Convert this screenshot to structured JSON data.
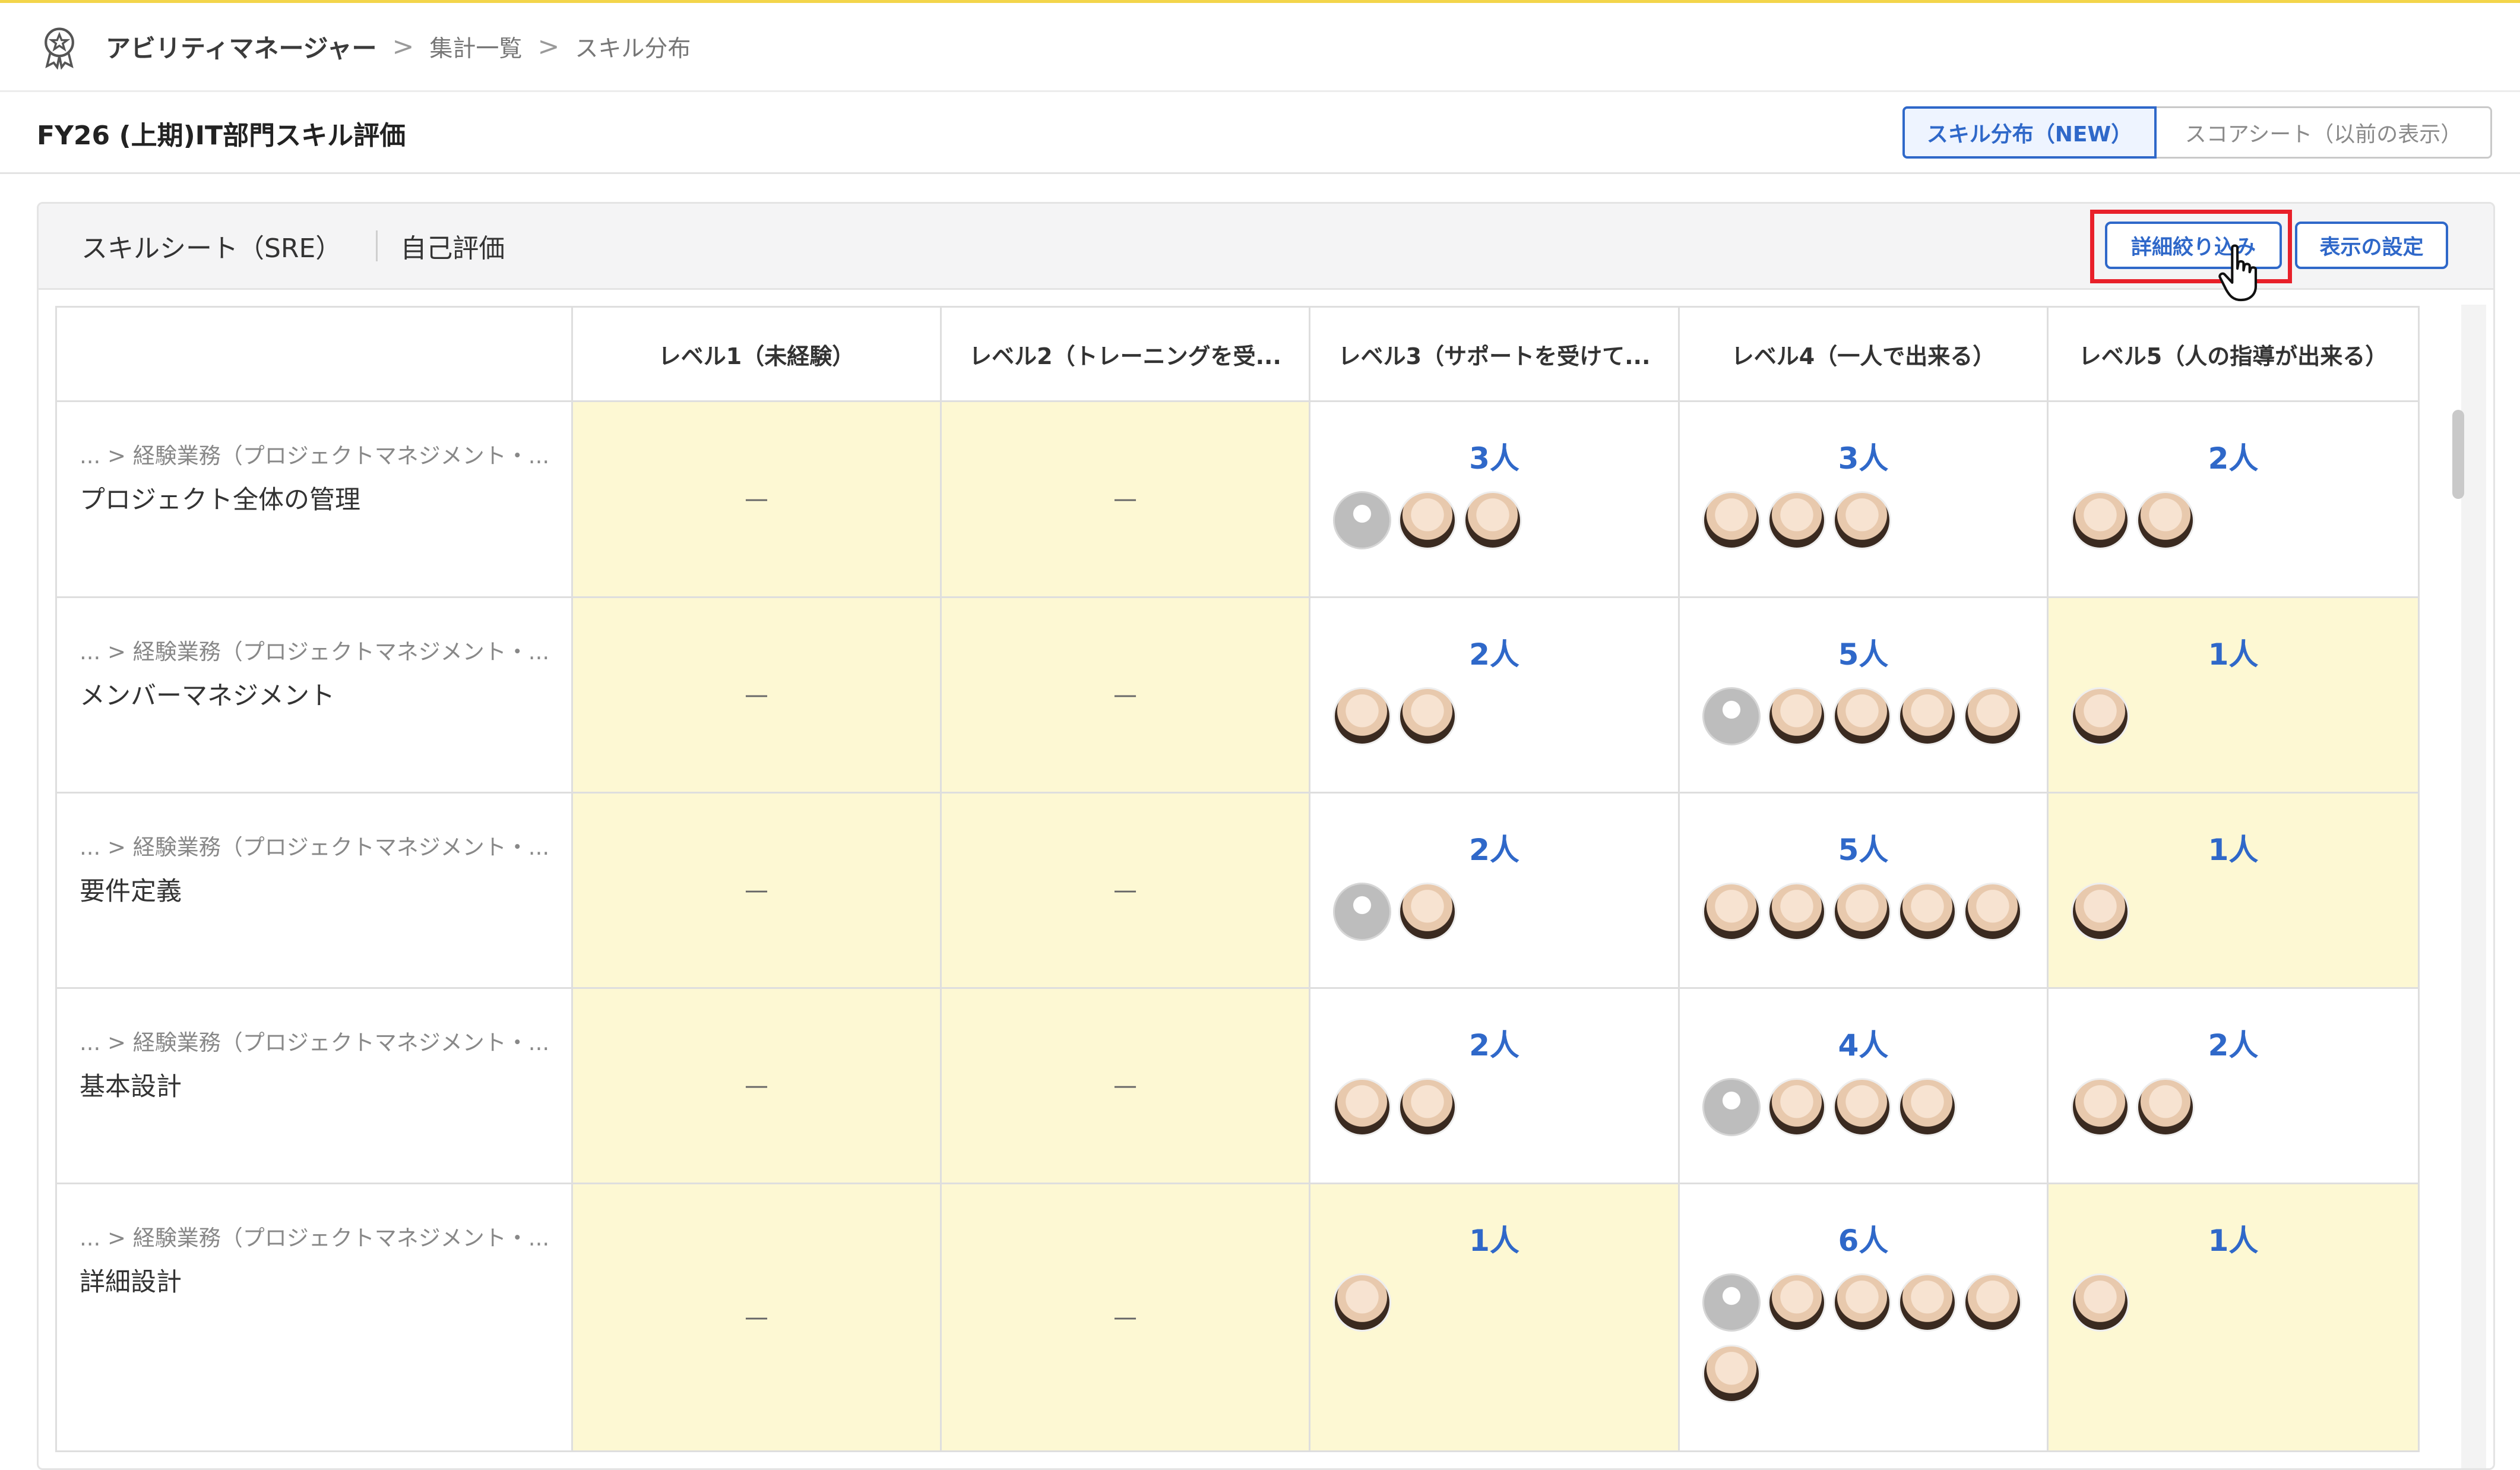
{
  "breadcrumb": {
    "app": "アビリティマネージャー",
    "sep1": ">",
    "item1": "集計一覧",
    "sep2": ">",
    "item2": "スキル分布",
    "logo_icon": "award-ribbon-icon"
  },
  "page": {
    "title": "FY26 (上期)IT部門スキル評価",
    "view_active": "スキル分布（NEW）",
    "view_inactive": "スコアシート（以前の表示）"
  },
  "panel": {
    "sheet_name": "スキルシート（SRE）",
    "eval_type": "自己評価",
    "filter_button": "詳細絞り込み",
    "settings_button": "表示の設定"
  },
  "colors": {
    "accent": "#2f68c9",
    "highlight_cell": "#fdf8d3",
    "annotation_red": "#e8202a"
  },
  "table": {
    "headers": [
      "",
      "レベル1（未経験）",
      "レベル2（トレーニングを受...",
      "レベル3（サポートを受けて...",
      "レベル4（一人で出来る）",
      "レベル5（人の指導が出来る）"
    ],
    "rows": [
      {
        "path": "... > 経験業務（プロジェクトマネジメント・...",
        "name": "プロジェクト全体の管理",
        "cells": [
          {
            "text": "—",
            "avatars": []
          },
          {
            "text": "—",
            "avatars": []
          },
          {
            "text": "3人",
            "avatars": [
              "anon",
              "p",
              "p"
            ]
          },
          {
            "text": "3人",
            "avatars": [
              "p",
              "p",
              "p"
            ]
          },
          {
            "text": "2人",
            "avatars": [
              "p",
              "p"
            ]
          }
        ]
      },
      {
        "path": "... > 経験業務（プロジェクトマネジメント・...",
        "name": "メンバーマネジメント",
        "cells": [
          {
            "text": "—",
            "avatars": []
          },
          {
            "text": "—",
            "avatars": []
          },
          {
            "text": "2人",
            "avatars": [
              "p",
              "p"
            ]
          },
          {
            "text": "5人",
            "avatars": [
              "anon",
              "p",
              "p",
              "p",
              "p"
            ]
          },
          {
            "text": "1人",
            "avatars": [
              "p"
            ]
          }
        ]
      },
      {
        "path": "... > 経験業務（プロジェクトマネジメント・...",
        "name": "要件定義",
        "cells": [
          {
            "text": "—",
            "avatars": []
          },
          {
            "text": "—",
            "avatars": []
          },
          {
            "text": "2人",
            "avatars": [
              "anon",
              "p"
            ]
          },
          {
            "text": "5人",
            "avatars": [
              "p",
              "p",
              "p",
              "p",
              "p"
            ]
          },
          {
            "text": "1人",
            "avatars": [
              "p"
            ]
          }
        ]
      },
      {
        "path": "... > 経験業務（プロジェクトマネジメント・...",
        "name": "基本設計",
        "cells": [
          {
            "text": "—",
            "avatars": []
          },
          {
            "text": "—",
            "avatars": []
          },
          {
            "text": "2人",
            "avatars": [
              "p",
              "p"
            ]
          },
          {
            "text": "4人",
            "avatars": [
              "anon",
              "p",
              "p",
              "p"
            ]
          },
          {
            "text": "2人",
            "avatars": [
              "p",
              "p"
            ]
          }
        ]
      },
      {
        "path": "... > 経験業務（プロジェクトマネジメント・...",
        "name": "詳細設計",
        "cells": [
          {
            "text": "—",
            "avatars": []
          },
          {
            "text": "—",
            "avatars": []
          },
          {
            "text": "1人",
            "avatars": [
              "p"
            ]
          },
          {
            "text": "6人",
            "avatars": [
              "anon",
              "p",
              "p",
              "p",
              "p",
              "p"
            ]
          },
          {
            "text": "1人",
            "avatars": [
              "p"
            ]
          }
        ]
      }
    ]
  }
}
